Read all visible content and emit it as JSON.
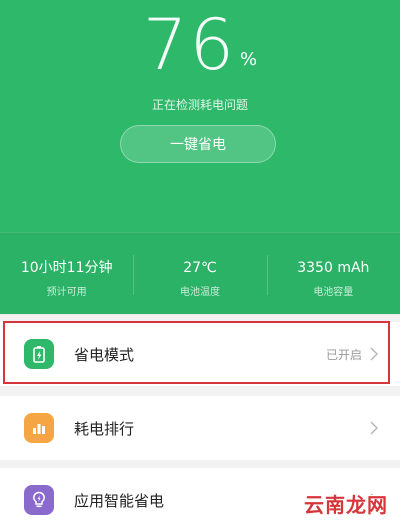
{
  "battery": {
    "percent": "76",
    "unit": "%",
    "status": "正在检测耗电问题",
    "save_button_label": "一键省电"
  },
  "stats": [
    {
      "value": "10小时11分钟",
      "label": "预计可用"
    },
    {
      "value": "27℃",
      "label": "电池温度"
    },
    {
      "value": "3350 mAh",
      "label": "电池容量"
    }
  ],
  "list": [
    {
      "title": "省电模式",
      "state": "已开启",
      "icon": "battery-save-icon",
      "color": "#2db86a"
    },
    {
      "title": "耗电排行",
      "state": "",
      "icon": "bar-chart-icon",
      "color": "#f5a544"
    },
    {
      "title": "应用智能省电",
      "state": "",
      "icon": "lightbulb-icon",
      "color": "#8a6acd"
    }
  ],
  "watermark": "云南龙网",
  "colors": {
    "primary_green": "#2db86a",
    "highlight_red": "#d6363a"
  }
}
